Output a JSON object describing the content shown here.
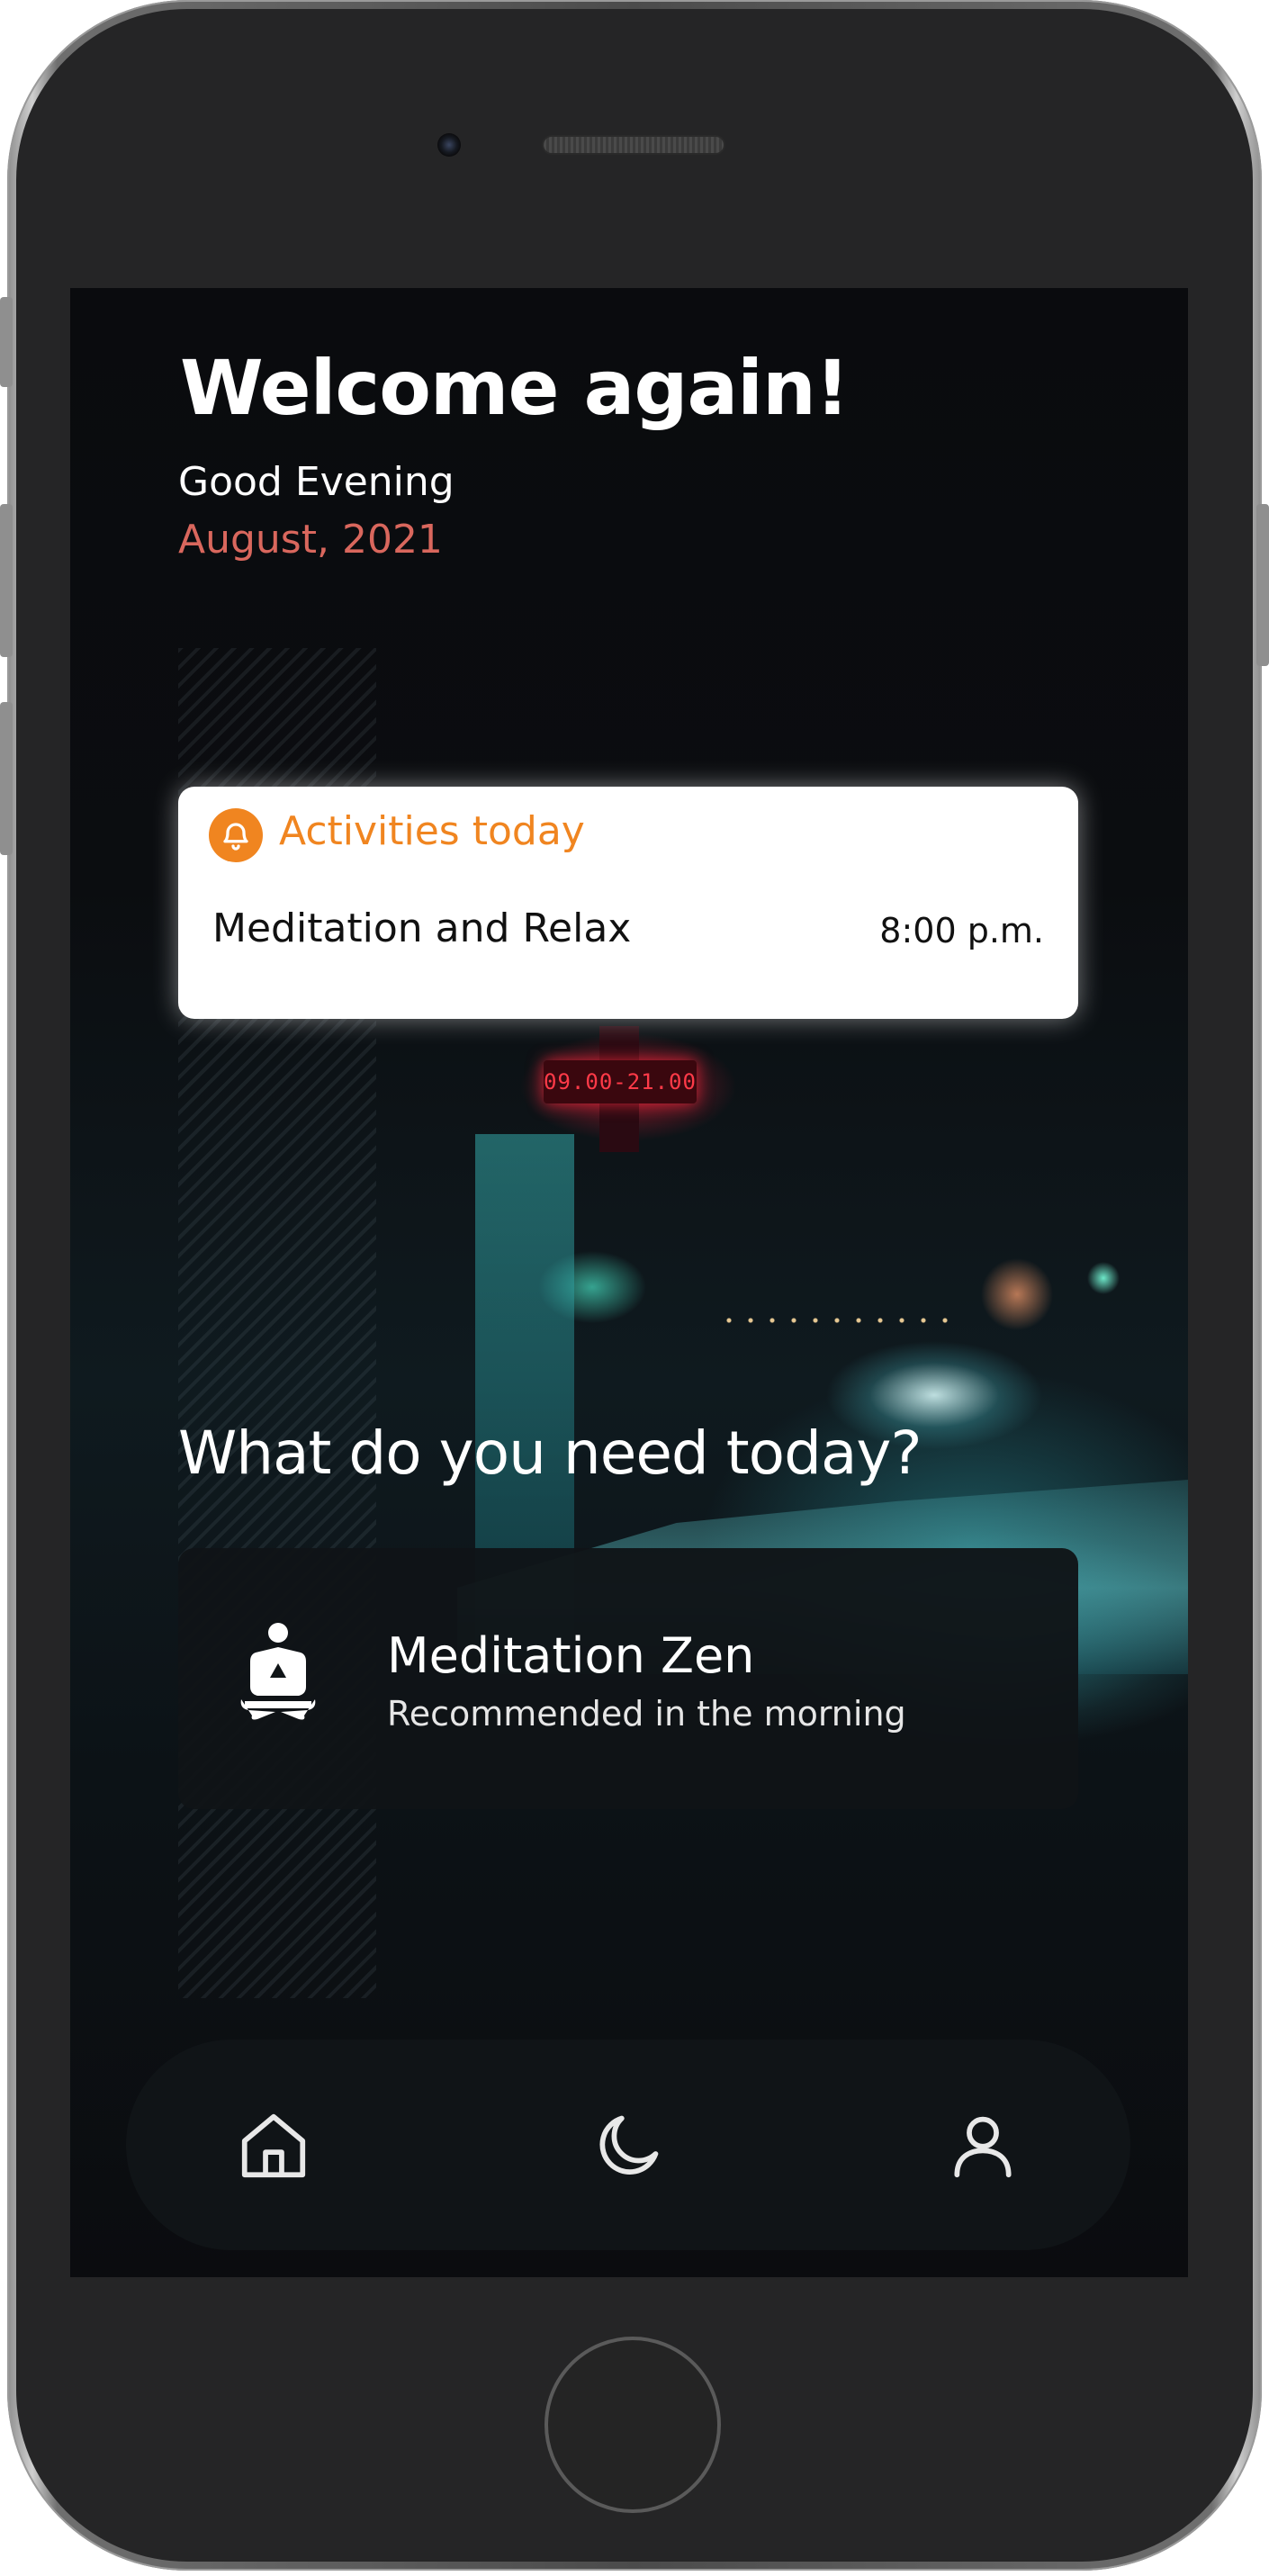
{
  "header": {
    "title": "Welcome again!",
    "greeting": "Good Evening",
    "date": "August, 2021"
  },
  "activities": {
    "title": "Activities today",
    "icon": "bell-icon",
    "item_name": "Meditation and Relax",
    "item_time": "8:00 p.m."
  },
  "background": {
    "sign_text": "09.00-21.00"
  },
  "section": {
    "question": "What do you need today?"
  },
  "option": {
    "icon": "meditation-icon",
    "title": "Meditation Zen",
    "subtitle": "Recommended in the morning"
  },
  "nav": {
    "items": [
      {
        "name": "home",
        "icon": "home-icon"
      },
      {
        "name": "sleep",
        "icon": "moon-icon"
      },
      {
        "name": "profile",
        "icon": "user-icon"
      }
    ]
  },
  "colors": {
    "accent_orange": "#f08520",
    "date_red": "#d9675d",
    "card_dark": "#101417",
    "screen_bg": "#0b0c0f"
  }
}
